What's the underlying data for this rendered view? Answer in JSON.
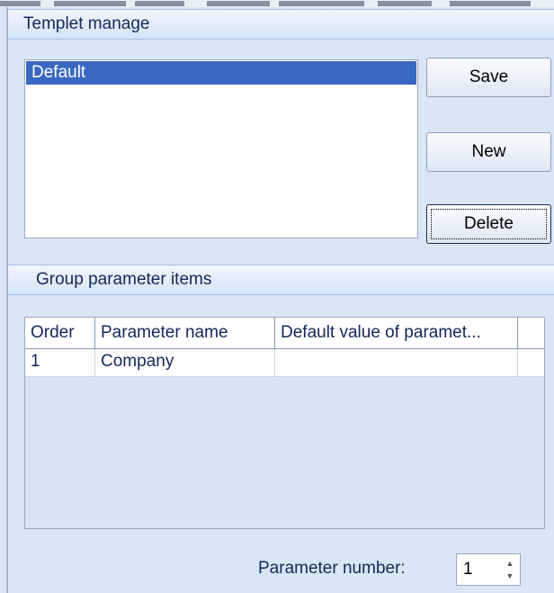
{
  "templet_manage": {
    "title": "Templet manage",
    "templates": [
      "Default"
    ],
    "selected": "Default",
    "buttons": {
      "save": "Save",
      "new": "New",
      "delete": "Delete"
    }
  },
  "group_params": {
    "title": "Group parameter items",
    "columns": [
      "Order",
      "Parameter name",
      "Default value of paramet..."
    ],
    "rows": [
      {
        "order": "1",
        "name": "Company",
        "default": ""
      }
    ]
  },
  "parameter_number": {
    "label": "Parameter number:",
    "value": "1"
  },
  "colors": {
    "selection": "#3968c2",
    "panel_bg": "#d9e6f5",
    "header_text": "#15275a"
  }
}
